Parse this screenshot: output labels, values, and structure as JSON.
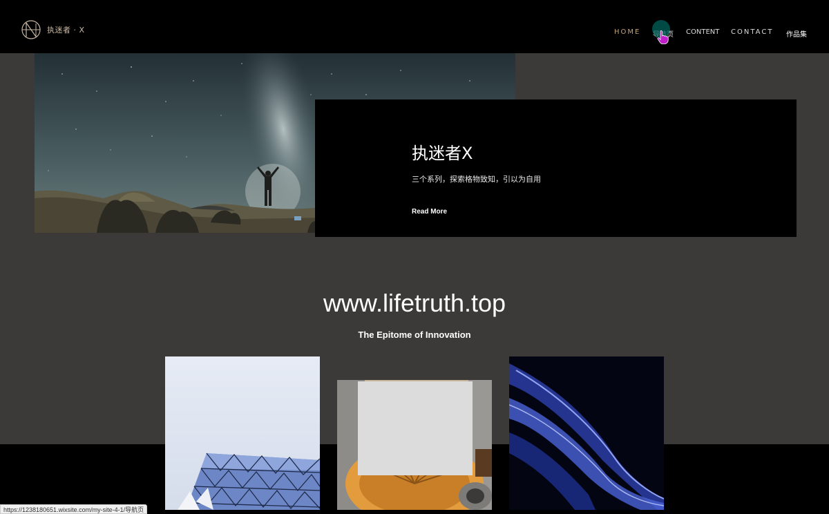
{
  "header": {
    "logo_text": "执迷者 · X",
    "nav": {
      "home": "HOME",
      "guide": "导航页",
      "content": "CONTENT",
      "contact": "CONTACT",
      "works": "作品集"
    }
  },
  "hero": {
    "title": "执迷者X",
    "subtitle": "三个系列，探索格物致知，引以为自用",
    "cta": "Read More"
  },
  "main": {
    "site_url": "www.lifetruth.top",
    "tagline": "The Epitome of Innovation"
  },
  "status_bar": {
    "url": "https://1238180651.wixsite.com/my-site-4-1/导航页"
  },
  "colors": {
    "background": "#3c3a38",
    "header": "#000000",
    "accent_gold": "#c2a47b",
    "cursor": "#c020c8"
  },
  "icons": [
    "logo-emblem-icon",
    "hand-pointer-cursor-icon"
  ]
}
